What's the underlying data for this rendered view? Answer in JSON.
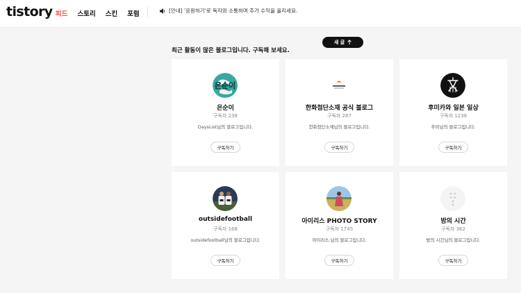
{
  "header": {
    "logo": "tistory",
    "nav": [
      "피드",
      "스토리",
      "스킨",
      "포럼"
    ],
    "notice": "[안내] '응원하기'로 독자와 소통하며 추가 수익을 올리세요."
  },
  "new_button": "새 글",
  "section_title": "최근 활동이 많은 블로그입니다. 구독해 보세요.",
  "subscribe_label": "구독하기",
  "blogs": [
    {
      "title": "은순이",
      "subscribers": "구독자 238",
      "description": "DaysList님의 블로그입니다.",
      "avatar": "globe-avatar",
      "avatar_text": "은순이"
    },
    {
      "title": "한화첨단소재 공식 블로그",
      "subscribers": "구독자 287",
      "description": "한화첨단소재님의 블로그입니다.",
      "avatar": "hanwha-logo-avatar"
    },
    {
      "title": "후미카와 일본 일상",
      "subscribers": "구독자 1236",
      "description": "후미님의 블로그입니다.",
      "avatar": "kanji-avatar"
    },
    {
      "title": "outsidefootball",
      "subscribers": "구독자 168",
      "description": "outsidefootball님의 블로그입니다.",
      "avatar": "football-players-avatar"
    },
    {
      "title": "아이리스 PHOTO STORY",
      "subscribers": "구독자 1745",
      "description": "아이리스.님의 블로그입니다.",
      "avatar": "field-photo-avatar"
    },
    {
      "title": "밤의 시간",
      "subscribers": "구독자 362",
      "description": "밤의 시간님의 블로그입니다.",
      "avatar": "default-dots-avatar"
    }
  ],
  "colors": {
    "accent": "#ef4b3c",
    "button_dark": "#111111",
    "background": "#f5f5f5"
  }
}
